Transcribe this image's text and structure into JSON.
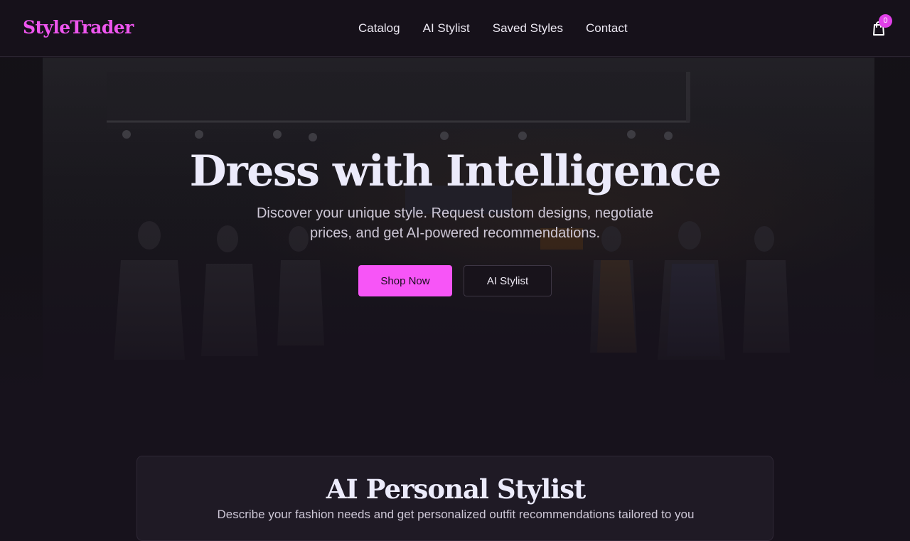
{
  "brand": {
    "name": "StyleTrader",
    "accent": "#f755f7"
  },
  "nav": {
    "items": [
      "Catalog",
      "AI Stylist",
      "Saved Styles",
      "Contact"
    ]
  },
  "cart": {
    "icon": "shopping-bag-icon",
    "count": "0"
  },
  "hero": {
    "title": "Dress with Intelligence",
    "subtitle": "Discover your unique style. Request custom designs, negotiate prices, and get AI-powered recommendations.",
    "primary_cta": "Shop Now",
    "secondary_cta": "AI Stylist"
  },
  "stylist_section": {
    "title": "AI Personal Stylist",
    "description": "Describe your fashion needs and get personalized outfit recommendations tailored to you"
  }
}
